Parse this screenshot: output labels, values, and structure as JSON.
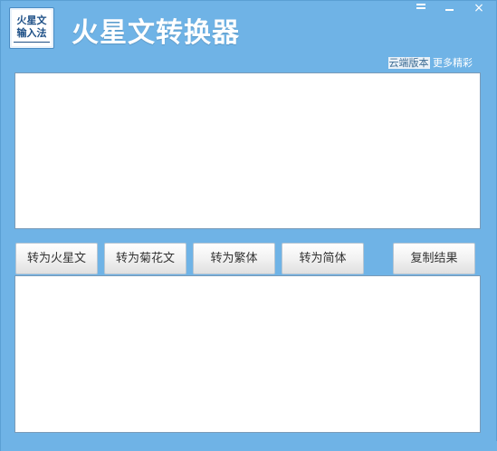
{
  "logo": {
    "line1": "火星文",
    "line2": "输入法"
  },
  "app_title": "火星文转换器",
  "window_controls": {
    "close": "×"
  },
  "links": {
    "cloud": "云端版本",
    "more": "更多精彩"
  },
  "input": {
    "value": ""
  },
  "output": {
    "value": ""
  },
  "buttons": {
    "to_huoxing": "转为火星文",
    "to_juhua": "转为菊花文",
    "to_fanti": "转为繁体",
    "to_jianti": "转为简体",
    "copy": "复制结果"
  },
  "colors": {
    "background": "#6fb3e6",
    "title": "#ffffff"
  }
}
